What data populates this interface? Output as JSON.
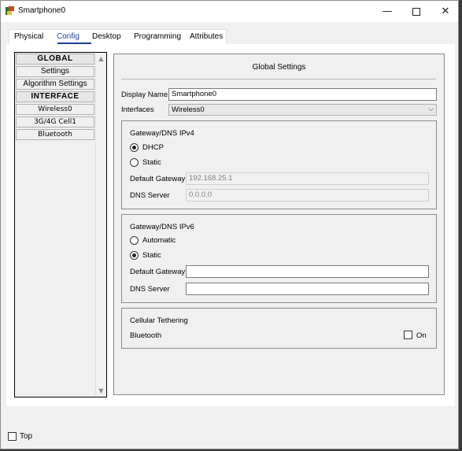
{
  "window": {
    "title": "Smartphone0",
    "min_glyph": "—",
    "close_glyph": "✕"
  },
  "tabs": [
    {
      "label": "Physical"
    },
    {
      "label": "Config",
      "active": true
    },
    {
      "label": "Desktop"
    },
    {
      "label": "Programming"
    },
    {
      "label": "Attributes"
    }
  ],
  "sidebar": {
    "items": [
      {
        "label": "GLOBAL",
        "type": "header"
      },
      {
        "label": "Settings"
      },
      {
        "label": "Algorithm Settings"
      },
      {
        "label": "INTERFACE",
        "type": "header"
      },
      {
        "label": "Wireless0"
      },
      {
        "label": "3G/4G Cell1"
      },
      {
        "label": "Bluetooth"
      }
    ],
    "scroll_up_glyph": "▲",
    "scroll_down_glyph": "▼"
  },
  "global_settings": {
    "title": "Global Settings",
    "display_name_label": "Display Name",
    "display_name_value": "Smartphone0",
    "interfaces_label": "Interfaces",
    "interfaces_value": "Wireless0",
    "select_arrow_glyph": "⌵"
  },
  "ipv4": {
    "title": "Gateway/DNS IPv4",
    "dhcp_label": "DHCP",
    "dhcp_checked": true,
    "static_label": "Static",
    "static_checked": false,
    "gateway_label": "Default Gateway",
    "gateway_value": "192.168.25.1",
    "dns_label": "DNS Server",
    "dns_value": "0.0.0.0"
  },
  "ipv6": {
    "title": "Gateway/DNS IPv6",
    "automatic_label": "Automatic",
    "automatic_checked": false,
    "static_label": "Static",
    "static_checked": true,
    "gateway_label": "Default Gateway",
    "gateway_value": "",
    "dns_label": "DNS Server",
    "dns_value": ""
  },
  "tethering": {
    "title": "Cellular Tethering",
    "bluetooth_label": "Bluetooth",
    "on_label": "On",
    "on_checked": false
  },
  "footer": {
    "top_label": "Top",
    "top_checked": false
  },
  "colors": {
    "active_tab": "#1f3f8f",
    "window_bg": "#f0f0f0"
  }
}
